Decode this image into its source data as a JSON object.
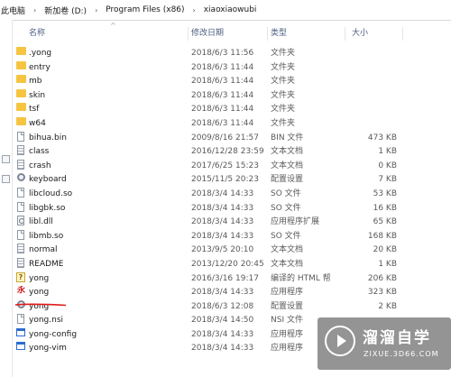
{
  "address": {
    "segments": [
      "此电脑",
      "新加卷 (D:)",
      "Program Files (x86)",
      "xiaoxiaowubi"
    ],
    "separator": "›"
  },
  "columns": {
    "name": "名称",
    "date": "修改日期",
    "type": "类型",
    "size": "大小"
  },
  "files": [
    {
      "name": ".yong",
      "date": "2018/6/3 11:56",
      "type": "文件夹",
      "size": "",
      "icon": "folder-icon"
    },
    {
      "name": "entry",
      "date": "2018/6/3 11:44",
      "type": "文件夹",
      "size": "",
      "icon": "folder-icon"
    },
    {
      "name": "mb",
      "date": "2018/6/3 11:44",
      "type": "文件夹",
      "size": "",
      "icon": "folder-icon"
    },
    {
      "name": "skin",
      "date": "2018/6/3 11:44",
      "type": "文件夹",
      "size": "",
      "icon": "folder-icon"
    },
    {
      "name": "tsf",
      "date": "2018/6/3 11:44",
      "type": "文件夹",
      "size": "",
      "icon": "folder-icon"
    },
    {
      "name": "w64",
      "date": "2018/6/3 11:44",
      "type": "文件夹",
      "size": "",
      "icon": "folder-icon"
    },
    {
      "name": "bihua.bin",
      "date": "2009/8/16 21:57",
      "type": "BIN 文件",
      "size": "473 KB",
      "icon": "file-icon"
    },
    {
      "name": "class",
      "date": "2016/12/28 23:59",
      "type": "文本文档",
      "size": "1 KB",
      "icon": "text-file-icon"
    },
    {
      "name": "crash",
      "date": "2017/6/25 15:23",
      "type": "文本文档",
      "size": "0 KB",
      "icon": "text-file-icon"
    },
    {
      "name": "keyboard",
      "date": "2015/11/5 20:23",
      "type": "配置设置",
      "size": "7 KB",
      "icon": "config-file-icon"
    },
    {
      "name": "libcloud.so",
      "date": "2018/3/4 14:33",
      "type": "SO 文件",
      "size": "53 KB",
      "icon": "file-icon"
    },
    {
      "name": "libgbk.so",
      "date": "2018/3/4 14:33",
      "type": "SO 文件",
      "size": "16 KB",
      "icon": "file-icon"
    },
    {
      "name": "libl.dll",
      "date": "2018/3/4 14:33",
      "type": "应用程序扩展",
      "size": "65 KB",
      "icon": "dll-file-icon"
    },
    {
      "name": "libmb.so",
      "date": "2018/3/4 14:33",
      "type": "SO 文件",
      "size": "168 KB",
      "icon": "file-icon"
    },
    {
      "name": "normal",
      "date": "2013/9/5 20:10",
      "type": "文本文档",
      "size": "20 KB",
      "icon": "text-file-icon"
    },
    {
      "name": "README",
      "date": "2013/12/20 20:45",
      "type": "文本文档",
      "size": "1 KB",
      "icon": "text-file-icon"
    },
    {
      "name": "yong",
      "date": "2016/3/16 19:17",
      "type": "编译的 HTML 帮",
      "size": "206 KB",
      "icon": "help-file-icon"
    },
    {
      "name": "yong",
      "date": "2018/3/4 14:33",
      "type": "应用程序",
      "size": "323 KB",
      "icon": "app-icon"
    },
    {
      "name": "yong",
      "date": "2018/6/3 12:08",
      "type": "配置设置",
      "size": "2 KB",
      "icon": "config-file-icon"
    },
    {
      "name": "yong.nsi",
      "date": "2018/3/4 14:50",
      "type": "NSI 文件",
      "size": "",
      "icon": "file-icon"
    },
    {
      "name": "yong-config",
      "date": "2018/3/4 14:33",
      "type": "应用程序",
      "size": "",
      "icon": "window-app-icon"
    },
    {
      "name": "yong-vim",
      "date": "2018/3/4 14:33",
      "type": "应用程序",
      "size": "",
      "icon": "window-app-icon"
    }
  ],
  "annotation_color": "#e01b1b",
  "watermark": {
    "title": "溜溜自学",
    "url": "ZIXUE.3D66.COM"
  }
}
